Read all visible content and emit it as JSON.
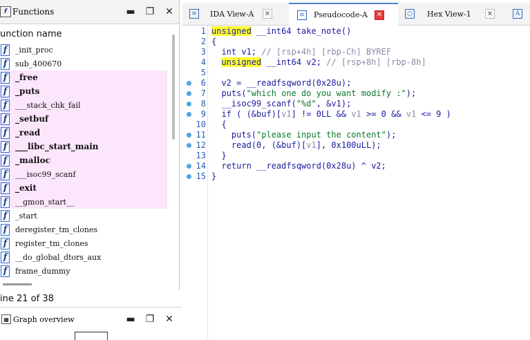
{
  "functions_panel": {
    "title": "Functions",
    "column_header": "unction name",
    "items": [
      {
        "name": "_init_proc",
        "bold": false,
        "pink": false
      },
      {
        "name": "sub_400670",
        "bold": false,
        "pink": false
      },
      {
        "name": "_free",
        "bold": true,
        "pink": true
      },
      {
        "name": "_puts",
        "bold": true,
        "pink": true
      },
      {
        "name": "___stack_chk_fail",
        "bold": false,
        "pink": true
      },
      {
        "name": "_setbuf",
        "bold": true,
        "pink": true
      },
      {
        "name": "_read",
        "bold": true,
        "pink": true
      },
      {
        "name": "___libc_start_main",
        "bold": true,
        "pink": true
      },
      {
        "name": "_malloc",
        "bold": true,
        "pink": true
      },
      {
        "name": "___isoc99_scanf",
        "bold": false,
        "pink": true
      },
      {
        "name": "_exit",
        "bold": true,
        "pink": true
      },
      {
        "name": "__gmon_start__",
        "bold": false,
        "pink": true
      },
      {
        "name": "_start",
        "bold": false,
        "pink": false
      },
      {
        "name": "deregister_tm_clones",
        "bold": false,
        "pink": false
      },
      {
        "name": "register_tm_clones",
        "bold": false,
        "pink": false
      },
      {
        "name": "__do_global_dtors_aux",
        "bold": false,
        "pink": false
      },
      {
        "name": "frame_dummy",
        "bold": false,
        "pink": false
      }
    ],
    "icon_glyph": "f",
    "status": "ine 21 of 38"
  },
  "graph_overview": {
    "title": "Graph overview"
  },
  "tabs": [
    {
      "label": "IDA View-A",
      "icon": "ida-view-icon",
      "active": false
    },
    {
      "label": "Pseudocode-A",
      "icon": "pseudocode-icon",
      "active": true
    },
    {
      "label": "Hex View-1",
      "icon": "hex-view-icon",
      "active": false
    },
    {
      "label": "A",
      "icon": "structures-icon",
      "active": false
    }
  ],
  "code_lines": [
    {
      "n": "1",
      "dot": false,
      "segs": [
        [
          "kw",
          "unsigned"
        ],
        [
          "plain",
          " __int64 take_note()"
        ]
      ]
    },
    {
      "n": "2",
      "dot": false,
      "segs": [
        [
          "plain",
          "{"
        ]
      ]
    },
    {
      "n": "3",
      "dot": false,
      "segs": [
        [
          "plain",
          "  int v1; "
        ],
        [
          "gray",
          "// [rsp+4h] [rbp-Ch] BYREF"
        ]
      ]
    },
    {
      "n": "4",
      "dot": false,
      "segs": [
        [
          "plain",
          "  "
        ],
        [
          "kw",
          "unsigned"
        ],
        [
          "plain",
          " __int64 v2; "
        ],
        [
          "gray",
          "// [rsp+8h] [rbp-8h]"
        ]
      ]
    },
    {
      "n": "5",
      "dot": false,
      "segs": [
        [
          "plain",
          ""
        ]
      ]
    },
    {
      "n": "6",
      "dot": true,
      "segs": [
        [
          "plain",
          "  v2 = __readfsqword(0x28u);"
        ]
      ]
    },
    {
      "n": "7",
      "dot": true,
      "segs": [
        [
          "plain",
          "  puts("
        ],
        [
          "green",
          "\"which one do you want modify :\""
        ],
        [
          "plain",
          ");"
        ]
      ]
    },
    {
      "n": "8",
      "dot": true,
      "segs": [
        [
          "plain",
          "  __isoc99_scanf("
        ],
        [
          "green",
          "\"%d\""
        ],
        [
          "plain",
          ", &v1);"
        ]
      ]
    },
    {
      "n": "9",
      "dot": true,
      "segs": [
        [
          "plain",
          "  if ( (&buf)["
        ],
        [
          "gray",
          "v1"
        ],
        [
          "plain",
          "] != 0LL && "
        ],
        [
          "gray",
          "v1"
        ],
        [
          "plain",
          " >= 0 && "
        ],
        [
          "gray",
          "v1"
        ],
        [
          "plain",
          " <= 9 )"
        ]
      ]
    },
    {
      "n": "10",
      "dot": false,
      "segs": [
        [
          "plain",
          "  {"
        ]
      ]
    },
    {
      "n": "11",
      "dot": true,
      "segs": [
        [
          "plain",
          "    puts("
        ],
        [
          "green",
          "\"please input the content\""
        ],
        [
          "plain",
          ");"
        ]
      ]
    },
    {
      "n": "12",
      "dot": true,
      "segs": [
        [
          "plain",
          "    read(0, (&buf)["
        ],
        [
          "gray",
          "v1"
        ],
        [
          "plain",
          "], 0x100uLL);"
        ]
      ]
    },
    {
      "n": "13",
      "dot": false,
      "segs": [
        [
          "plain",
          "  }"
        ]
      ]
    },
    {
      "n": "14",
      "dot": true,
      "segs": [
        [
          "plain",
          "  return __readfsqword(0x28u) ^ v2;"
        ]
      ]
    },
    {
      "n": "15",
      "dot": true,
      "segs": [
        [
          "plain",
          "}"
        ]
      ]
    }
  ],
  "window_buttons": {
    "minimize": "▬",
    "restore": "❐",
    "close": "✕"
  }
}
